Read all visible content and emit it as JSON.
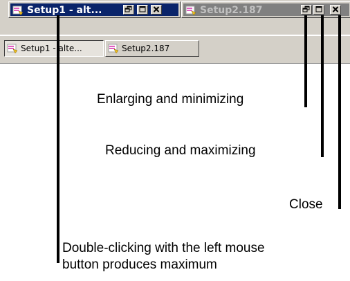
{
  "windows": [
    {
      "title": "Setup1 - alt...",
      "state": "active"
    },
    {
      "title": "Setup2.187",
      "state": "inactive"
    }
  ],
  "controls": {
    "restore_icon": "restore-icon",
    "maximize_icon": "maximize-icon",
    "close_icon": "close-icon"
  },
  "taskbar": [
    {
      "label": "Setup1 - alte...",
      "pressed": true
    },
    {
      "label": "Setup2.187",
      "pressed": false
    }
  ],
  "callouts": {
    "enlarge": "Enlarging and minimizing",
    "reduce": "Reducing and maximizing",
    "close": "Close",
    "dbl_line1": "Double-clicking with the left mouse",
    "dbl_line2": "button produces maximum"
  },
  "colors": {
    "active_caption": "#0a246a",
    "inactive_caption": "#808080",
    "face": "#d4d0c8"
  }
}
